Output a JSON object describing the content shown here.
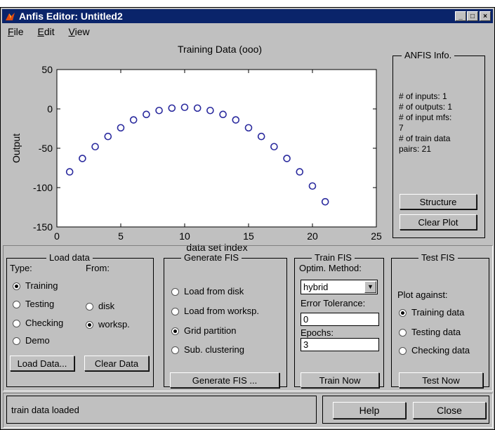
{
  "window": {
    "title": "Anfis Editor: Untitled2"
  },
  "menu": [
    "File",
    "Edit",
    "View"
  ],
  "plot": {
    "title": "Training Data (ooo)",
    "ylabel": "Output",
    "xlabel": "data set index",
    "marker_color": "#2b2b9e"
  },
  "chart_data": {
    "type": "scatter",
    "title": "Training Data (ooo)",
    "xlabel": "data set index",
    "ylabel": "Output",
    "xlim": [
      0,
      25
    ],
    "ylim": [
      -150,
      50
    ],
    "xticks": [
      "0",
      "5",
      "10",
      "15",
      "20",
      "25"
    ],
    "yticks": [
      "50",
      "0",
      "-50",
      "-100",
      "-150"
    ],
    "x": [
      1,
      2,
      3,
      4,
      5,
      6,
      7,
      8,
      9,
      10,
      11,
      12,
      13,
      14,
      15,
      16,
      17,
      18,
      19,
      20,
      21
    ],
    "y": [
      -80,
      -63,
      -48,
      -35,
      -24,
      -14,
      -7,
      -2,
      1,
      2,
      1,
      -2,
      -7,
      -14,
      -24,
      -35,
      -48,
      -63,
      -80,
      -98,
      -118
    ]
  },
  "anfis_info": {
    "legend": "ANFIS Info.",
    "lines": [
      "# of inputs: 1",
      "# of outputs: 1",
      "# of input mfs:",
      "7",
      "# of train data",
      "pairs: 21"
    ],
    "structure_button": "Structure",
    "clear_plot_button": "Clear Plot"
  },
  "load_data": {
    "legend": "Load data",
    "type_label": "Type:",
    "from_label": "From:",
    "types": [
      "Training",
      "Testing",
      "Checking",
      "Demo"
    ],
    "sources": [
      "disk",
      "worksp."
    ],
    "load_button": "Load Data...",
    "clear_button": "Clear Data"
  },
  "generate_fis": {
    "legend": "Generate FIS",
    "options": [
      "Load from disk",
      "Load from worksp.",
      "Grid partition",
      "Sub. clustering"
    ],
    "button": "Generate FIS ..."
  },
  "train_fis": {
    "legend": "Train FIS",
    "method_label": "Optim. Method:",
    "method_value": "hybrid",
    "tolerance_label": "Error Tolerance:",
    "tolerance_value": "0",
    "epochs_label": "Epochs:",
    "epochs_value": "3",
    "button": "Train Now"
  },
  "test_fis": {
    "legend": "Test FIS",
    "plot_against": "Plot against:",
    "options": [
      "Training data",
      "Testing data",
      "Checking data"
    ],
    "button": "Test Now"
  },
  "status": {
    "message": "train data loaded",
    "help_button": "Help",
    "close_button": "Close"
  }
}
